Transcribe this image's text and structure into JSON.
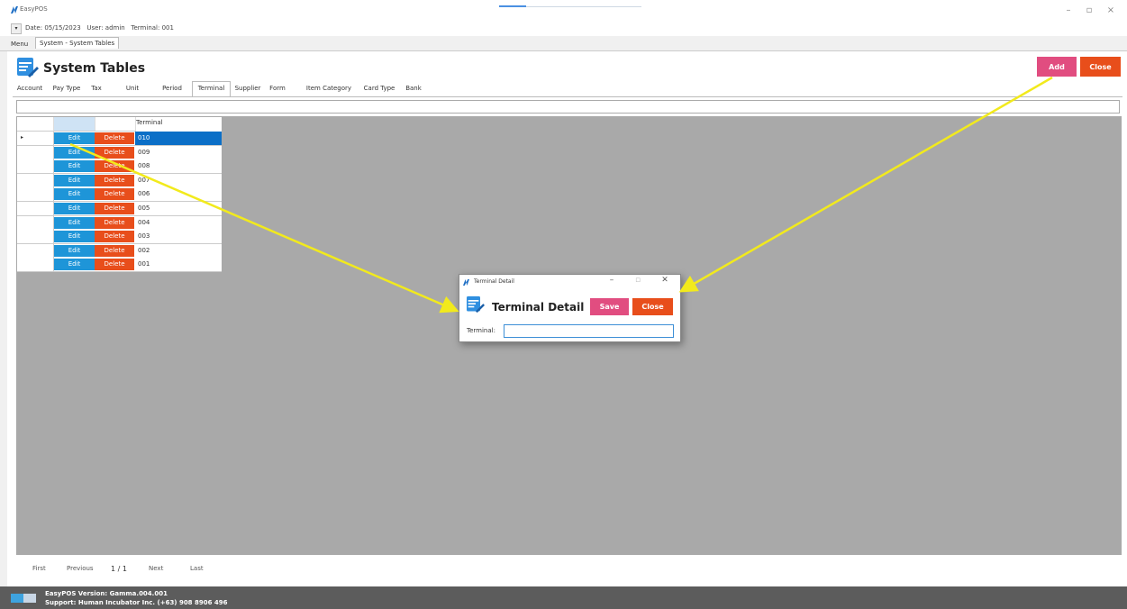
{
  "app": {
    "title": "EasyPOS"
  },
  "info": {
    "date": "Date: 05/15/2023",
    "user": "User: admin",
    "terminal": "Terminal: 001"
  },
  "app_tabs": {
    "menu": "Menu",
    "system": "System - System Tables"
  },
  "page": {
    "title": "System Tables",
    "add_label": "Add",
    "close_label": "Close"
  },
  "system_tabs": [
    "Account",
    "Pay Type",
    "Tax",
    "Unit",
    "Period",
    "Terminal",
    "Supplier",
    "Form",
    "Item Category",
    "Card Type",
    "Bank"
  ],
  "active_system_tab": "Terminal",
  "grid": {
    "column_header": "Terminal",
    "edit_label": "Edit",
    "delete_label": "Delete",
    "rows": [
      "010",
      "009",
      "008",
      "007",
      "006",
      "005",
      "004",
      "003",
      "002",
      "001"
    ]
  },
  "pager": {
    "first": "First",
    "previous": "Previous",
    "page": "1 / 1",
    "next": "Next",
    "last": "Last"
  },
  "footer": {
    "version": "EasyPOS Version: Gamma.004.001",
    "support": "Support: Human Incubator Inc. (+63) 908 8906 496"
  },
  "dialog": {
    "window_title": "Terminal Detail",
    "heading": "Terminal Detail",
    "save_label": "Save",
    "close_label": "Close",
    "field_label": "Terminal:",
    "field_value": ""
  },
  "colors": {
    "add": "#e14d80",
    "close": "#e84e1b",
    "edit": "#1e95d8",
    "selected": "#0b6fc7",
    "annotation_arrow": "#f2ea1c"
  }
}
